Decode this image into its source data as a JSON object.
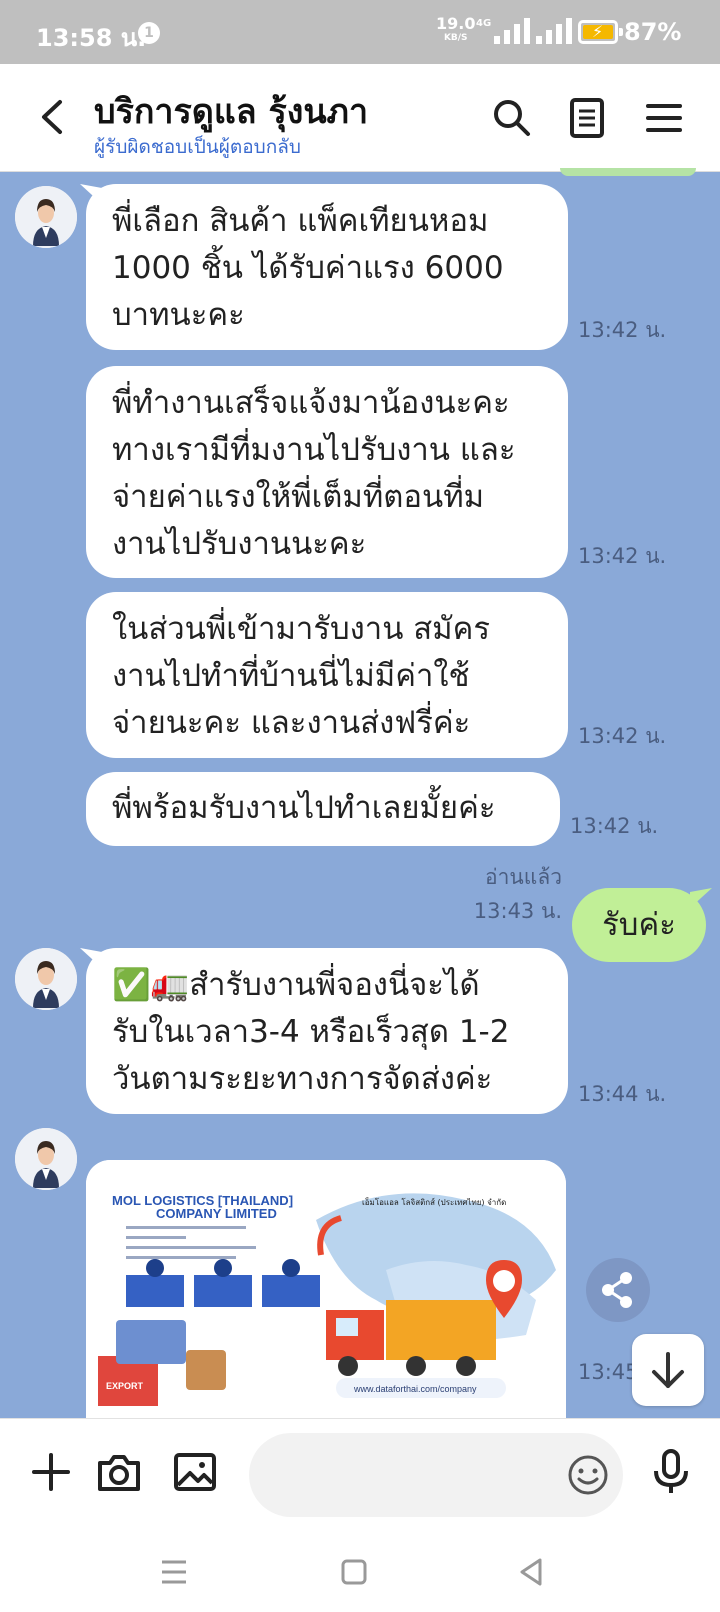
{
  "status_bar": {
    "time": "13:58 น.",
    "notification_count": "1",
    "net_speed": "19.0",
    "net_unit": "KB/S",
    "network": "4G",
    "battery": "87%"
  },
  "header": {
    "title": "บริการดูแล รุ้งนภา",
    "subtitle": "ผู้รับผิดชอบเป็นผู้ตอบกลับ"
  },
  "messages": [
    {
      "lines": [
        "พี่เลือก สินค้า แพ็คเทียนหอม",
        "1000 ชิ้น ได้รับค่าแรง 6000",
        "บาทนะคะ"
      ],
      "time": "13:42 น."
    },
    {
      "lines": [
        "พี่ทำงานเสร็จแจ้งมาน้องนะคะ",
        "ทางเรามีที่มงานไปรับงาน และ",
        "จ่ายค่าแรงให้พี่เต็มที่ตอนที่ม",
        "งานไปรับงานนะคะ"
      ],
      "time": "13:42 น."
    },
    {
      "lines": [
        "ในส่วนพี่เข้ามารับงาน  สมัคร",
        "งานไปทำที่บ้านนี่ไม่มีค่าใช้",
        "จ่ายนะคะ และงานส่งฟรี่ค่ะ"
      ],
      "time": "13:42 น."
    },
    {
      "lines": [
        "พี่พร้อมรับงานไปทำเลยมั้ยค่ะ"
      ],
      "time": "13:42 น."
    },
    {
      "lines": [
        "✅🚛สำรับงานพี่จองนี่จะได้",
        "รับในเวลา3-4 หรือเร็วสุด 1-2",
        "วันตามระยะทางการจัดส่งค่ะ"
      ],
      "time": "13:44 น."
    }
  ],
  "my_message": {
    "text": "รับค่ะ",
    "read_label": "อ่านแล้ว",
    "time": "13:43 น."
  },
  "image_message": {
    "company_line1": "MOL LOGISTICS [THAILAND]",
    "company_line2": "COMPANY LIMITED",
    "thai_name": "เอ็มโอแอล โลจิสติกส์ (ประเทศไทย) จำกัด",
    "box_label": "EXPORT",
    "url": "www.dataforthai.com/company",
    "time": "13:45 น."
  },
  "input": {
    "placeholder": ""
  },
  "icons": {
    "back": "chevron-left-icon",
    "search": "search-icon",
    "notes": "notes-icon",
    "menu": "hamburger-menu-icon",
    "plus": "plus-icon",
    "camera": "camera-icon",
    "image": "image-icon",
    "emoji": "emoji-icon",
    "mic": "microphone-icon",
    "share": "share-icon",
    "scroll_down": "arrow-down-icon"
  },
  "colors": {
    "chat_bg": "#8aa9d8",
    "my_bubble": "#c1ef97",
    "subtitle_link": "#3b6bcf",
    "status_bar": "#bfbfbf"
  }
}
